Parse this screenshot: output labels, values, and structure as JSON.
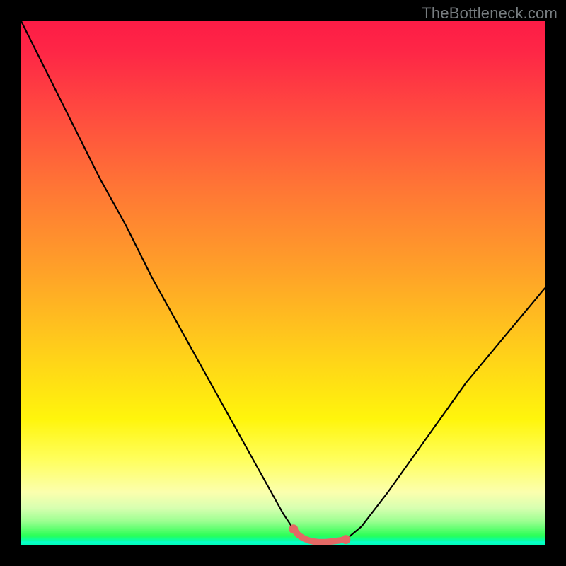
{
  "watermark": {
    "text": "TheBottleneck.com"
  },
  "colors": {
    "frame": "#000000",
    "curve_stroke": "#000000",
    "highlight_stroke": "#e46965",
    "gradient_top": "#fd1c46",
    "gradient_bottom": "#00ffb6"
  },
  "chart_data": {
    "type": "line",
    "title": "",
    "xlabel": "",
    "ylabel": "",
    "xlim": [
      0,
      100
    ],
    "ylim": [
      0,
      100
    ],
    "grid": false,
    "series": [
      {
        "name": "curve",
        "x": [
          0,
          2,
          5,
          10,
          15,
          20,
          25,
          30,
          35,
          40,
          45,
          50,
          52,
          54,
          56,
          58,
          60,
          62,
          65,
          70,
          75,
          80,
          85,
          90,
          95,
          100
        ],
        "y": [
          100,
          96,
          90,
          80,
          70,
          61,
          51,
          42,
          33,
          24,
          15,
          6,
          3,
          1.2,
          0.6,
          0.5,
          0.5,
          1.0,
          3.5,
          10,
          17,
          24,
          31,
          37,
          43,
          49
        ]
      },
      {
        "name": "highlight-segment",
        "x": [
          52,
          53,
          54,
          55,
          56,
          57,
          58,
          59,
          60,
          61,
          62
        ],
        "y": [
          3.0,
          1.8,
          1.2,
          0.8,
          0.6,
          0.5,
          0.5,
          0.6,
          0.7,
          0.85,
          1.0
        ]
      }
    ],
    "annotations": []
  }
}
